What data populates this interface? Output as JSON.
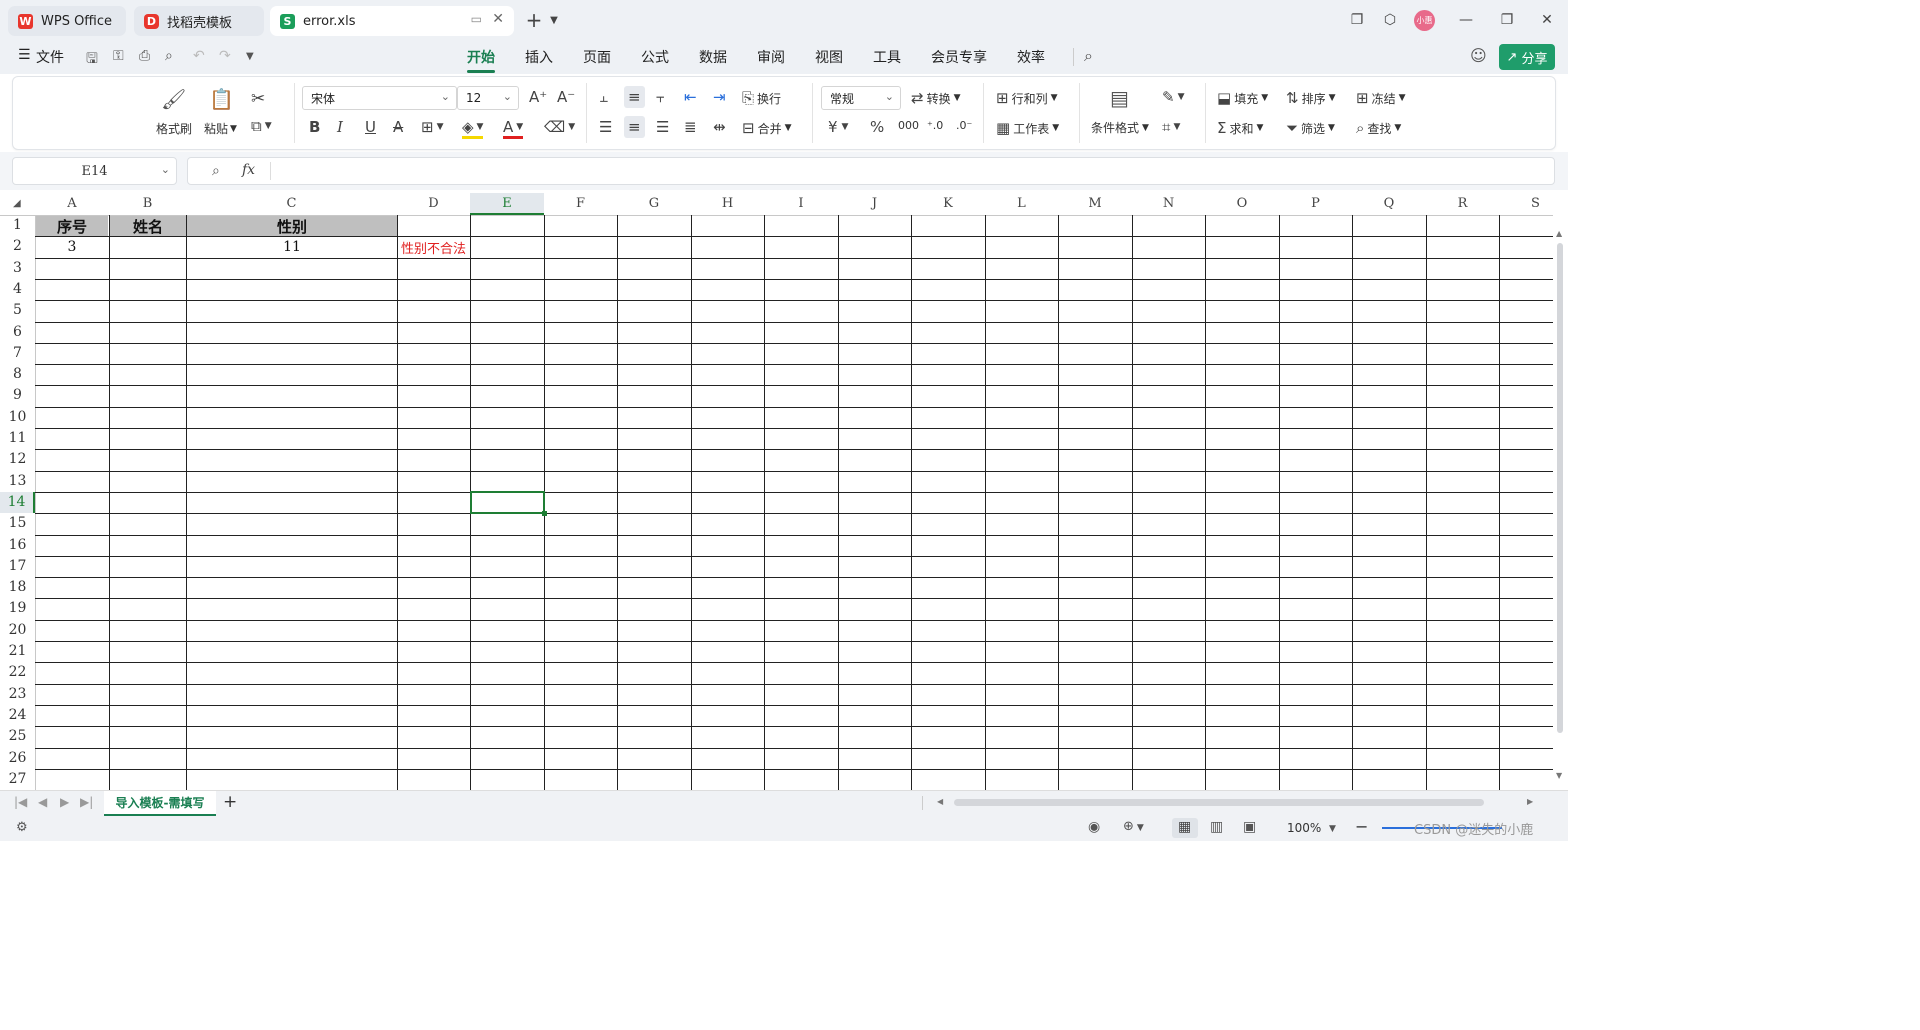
{
  "tabs": [
    {
      "label": "WPS Office",
      "icon": "wps-logo-icon"
    },
    {
      "label": "找稻壳模板",
      "icon": "docer-icon"
    },
    {
      "label": "error.xls",
      "icon": "spreadsheet-icon"
    }
  ],
  "user_avatar": "小惠",
  "menu": {
    "file_label": "文件",
    "tabs": [
      "开始",
      "插入",
      "页面",
      "公式",
      "数据",
      "审阅",
      "视图",
      "工具",
      "会员专享",
      "效率"
    ],
    "active_tab": "开始",
    "share_label": "分享"
  },
  "ribbon": {
    "format_painter": "格式刷",
    "paste": "粘贴",
    "font_name": "宋体",
    "font_size": "12",
    "wrap": "换行",
    "merge": "合并",
    "number_format": "常规",
    "convert": "转换",
    "row_col": "行和列",
    "worksheet": "工作表",
    "cond_format": "条件格式",
    "fill": "填充",
    "sort": "排序",
    "freeze": "冻结",
    "sum": "求和",
    "filter": "筛选",
    "find": "查找",
    "currency_symbol": "¥",
    "percent_symbol": "%",
    "thousands_symbol": "000"
  },
  "formula_bar": {
    "cell_ref": "E14",
    "fx": "fx",
    "value": ""
  },
  "sheet": {
    "columns": [
      "A",
      "B",
      "C",
      "D",
      "E",
      "F",
      "G",
      "H",
      "I",
      "J",
      "K",
      "L",
      "M",
      "N",
      "O",
      "P",
      "Q",
      "R",
      "S"
    ],
    "rows": [
      "1",
      "2",
      "3",
      "4",
      "5",
      "6",
      "7",
      "8",
      "9",
      "10",
      "11",
      "12",
      "13",
      "14",
      "15",
      "16",
      "17",
      "18",
      "19",
      "20",
      "21",
      "22",
      "23",
      "24",
      "25",
      "26",
      "27"
    ],
    "headers": [
      "序号",
      "姓名",
      "性别"
    ],
    "row2": {
      "a": "3",
      "b": "",
      "c": "11",
      "d": "性别不合法"
    },
    "selected_cell": "E14",
    "error_color": "#e02020",
    "header_fill": "#bfbfbf",
    "selection_color": "#1e7e34"
  },
  "sheet_tab": {
    "name": "导入模板-需填写",
    "add": "+"
  },
  "status": {
    "zoom": "100%",
    "watermark": "CSDN @迷失的小鹿"
  }
}
